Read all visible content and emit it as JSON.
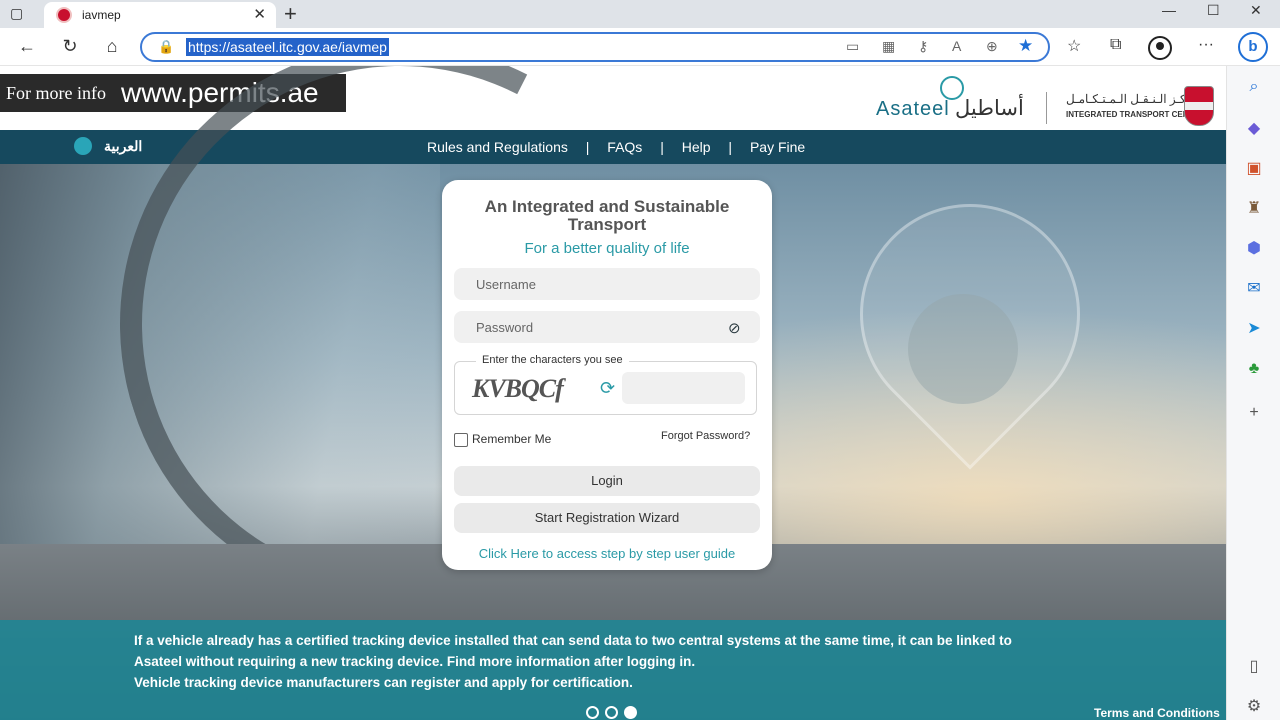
{
  "browser": {
    "tab_title": "iavmep",
    "url": "https://asateel.itc.gov.ae/iavmep",
    "new_tab": "+",
    "tab_close": "✕"
  },
  "page": {
    "info_banner": {
      "prefix": "For more info",
      "site": "www.permits.ae"
    },
    "logo": {
      "asateel_en": "Asateel",
      "asateel_ar": "أساطيل",
      "itc_ar": "مـركـز الـنـقـل الـمـتـكـامـل",
      "itc_en": "INTEGRATED TRANSPORT CENTRE"
    },
    "nav": {
      "language": "العربية",
      "links": [
        "Rules and Regulations",
        "|",
        "FAQs",
        "|",
        "Help",
        "|",
        "Pay Fine"
      ]
    },
    "login": {
      "title": "An Integrated and Sustainable Transport",
      "subtitle": "For a better quality of life",
      "username_placeholder": "Username",
      "password_placeholder": "Password",
      "captcha_label": "Enter the characters you see",
      "captcha_text": "KVBQCf",
      "remember": "Remember Me",
      "forgot": "Forgot Password?",
      "login_button": "Login",
      "register_button": "Start Registration Wizard",
      "guide_link": "Click Here to access step by step user guide"
    },
    "caption": {
      "line1": "If a vehicle already has a certified tracking device installed that can send data to two central systems at the same time, it can be linked to",
      "line2": "Asateel without requiring a new tracking device. Find more information after logging in.",
      "line3": "Vehicle tracking device manufacturers can register and apply for certification."
    },
    "terms": "Terms and Conditions",
    "carousel": {
      "count": 3,
      "active_index": 3
    }
  },
  "colors": {
    "accent": "#2a9aa6",
    "nav_bg": "#16495e",
    "band": "#1b8796"
  }
}
